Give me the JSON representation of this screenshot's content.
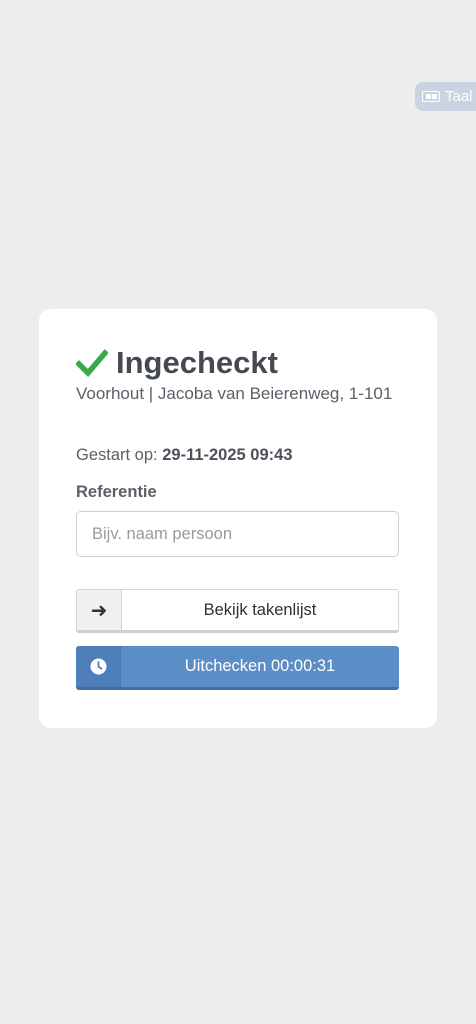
{
  "language": {
    "label": "Taal",
    "icon": "language-icon"
  },
  "status": {
    "title": "Ingecheckt",
    "icon": "checkmark-icon",
    "icon_color": "#3aa84a",
    "address": "Voorhout | Jacoba van Beierenweg, 1-101"
  },
  "started": {
    "label": "Gestart op:",
    "value": "29-11-2025 09:43"
  },
  "reference": {
    "label": "Referentie",
    "placeholder": "Bijv. naam persoon",
    "value": ""
  },
  "buttons": {
    "tasks": {
      "label": "Bekijk takenlijst",
      "icon": "arrow-right-icon",
      "glyph": "➜"
    },
    "checkout": {
      "label": "Uitchecken 00:00:31",
      "icon": "clock-icon",
      "color": "#5b8dc6"
    }
  }
}
